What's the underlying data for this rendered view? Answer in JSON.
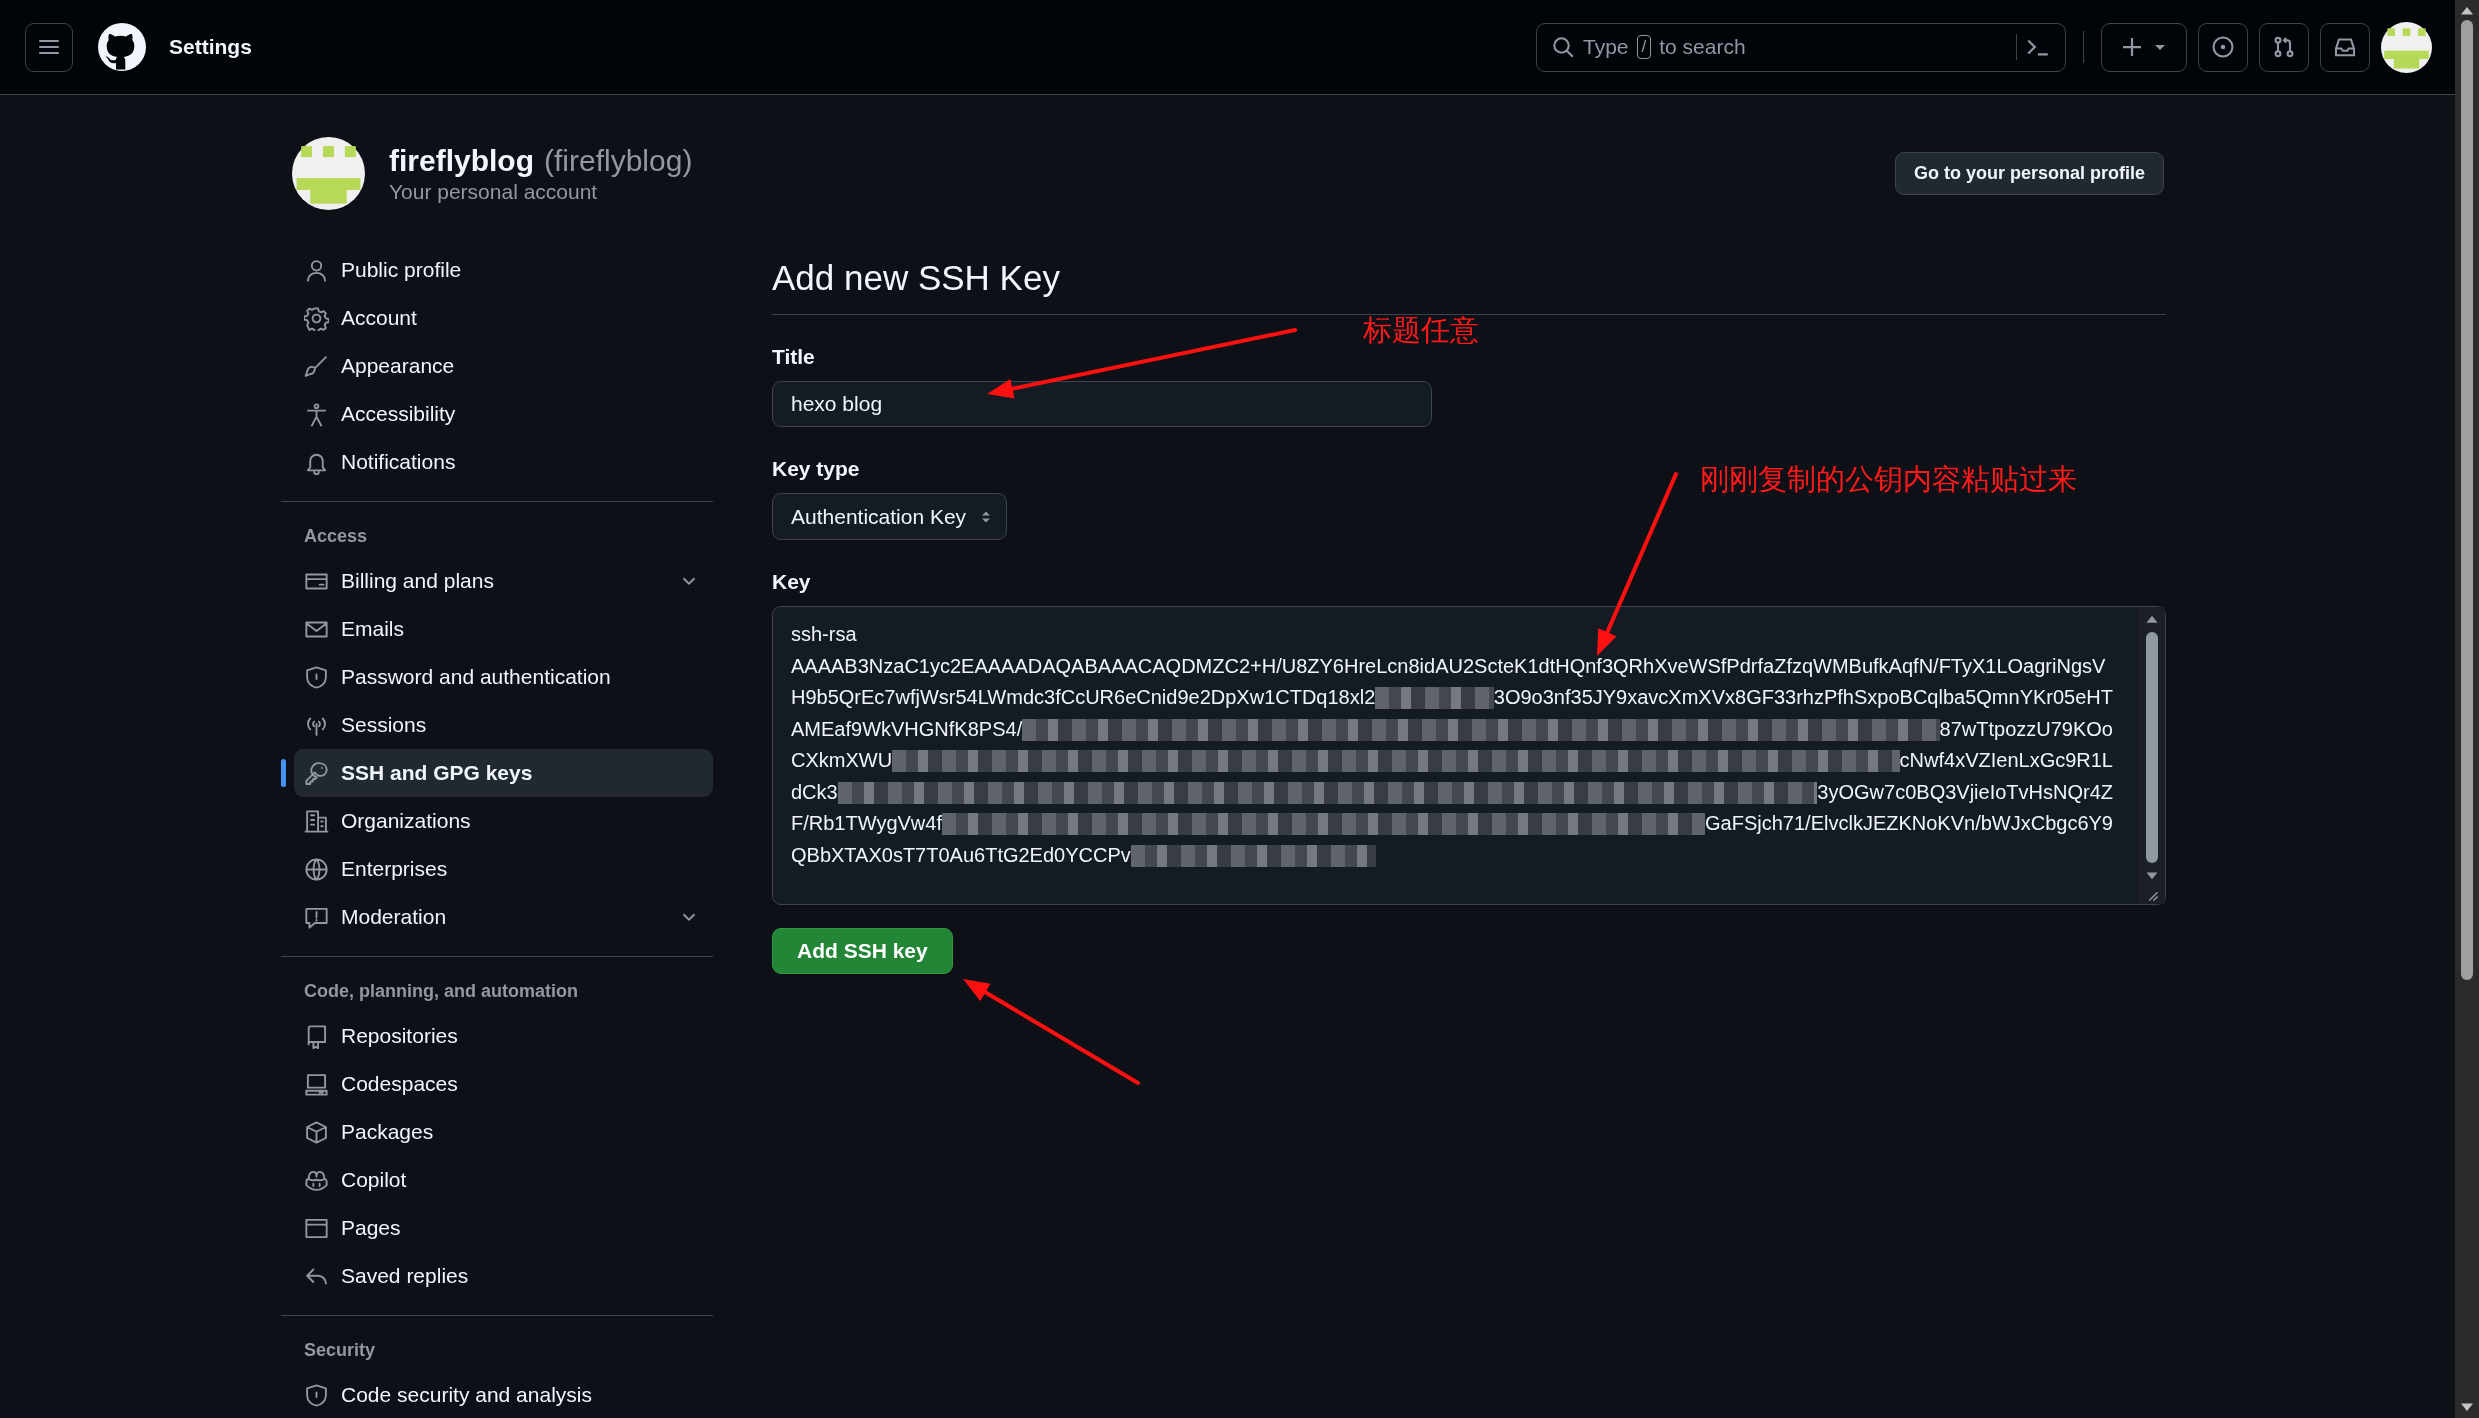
{
  "header": {
    "title": "Settings",
    "search": {
      "hint_start": "Type",
      "hint_key": "/",
      "hint_end": "to search"
    }
  },
  "profile": {
    "name": "fireflyblog",
    "login": "(fireflyblog)",
    "subtitle": "Your personal account",
    "button": "Go to your personal profile"
  },
  "sidebar": {
    "sections": [
      {
        "items": [
          {
            "label": "Public profile",
            "selected": false,
            "expandable": false
          },
          {
            "label": "Account",
            "selected": false,
            "expandable": false
          },
          {
            "label": "Appearance",
            "selected": false,
            "expandable": false
          },
          {
            "label": "Accessibility",
            "selected": false,
            "expandable": false
          },
          {
            "label": "Notifications",
            "selected": false,
            "expandable": false
          }
        ]
      },
      {
        "heading": "Access",
        "items": [
          {
            "label": "Billing and plans",
            "selected": false,
            "expandable": true
          },
          {
            "label": "Emails",
            "selected": false,
            "expandable": false
          },
          {
            "label": "Password and authentication",
            "selected": false,
            "expandable": false
          },
          {
            "label": "Sessions",
            "selected": false,
            "expandable": false
          },
          {
            "label": "SSH and GPG keys",
            "selected": true,
            "expandable": false
          },
          {
            "label": "Organizations",
            "selected": false,
            "expandable": false
          },
          {
            "label": "Enterprises",
            "selected": false,
            "expandable": false
          },
          {
            "label": "Moderation",
            "selected": false,
            "expandable": true
          }
        ]
      },
      {
        "heading": "Code, planning, and automation",
        "items": [
          {
            "label": "Repositories",
            "selected": false,
            "expandable": false
          },
          {
            "label": "Codespaces",
            "selected": false,
            "expandable": false
          },
          {
            "label": "Packages",
            "selected": false,
            "expandable": false
          },
          {
            "label": "Copilot",
            "selected": false,
            "expandable": false
          },
          {
            "label": "Pages",
            "selected": false,
            "expandable": false
          },
          {
            "label": "Saved replies",
            "selected": false,
            "expandable": false
          }
        ]
      },
      {
        "heading": "Security",
        "items": [
          {
            "label": "Code security and analysis",
            "selected": false,
            "expandable": false
          }
        ]
      }
    ]
  },
  "form": {
    "heading": "Add new SSH Key",
    "title_label": "Title",
    "title_value": "hexo blog",
    "type_label": "Key type",
    "type_value": "Authentication Key",
    "key_label": "Key",
    "key_lines": [
      {
        "start": "ssh-rsa",
        "redacted": false
      },
      {
        "start": "AAAAB3NzaC1yc2EAAAADAQABAAACAQDMZC2+H/U8ZY6HreLcn8idAU2ScteK1dtHQnf3QRhXveWSfPdrfaZfzqWMBufkAqfN/FTyX1LOagriNgsV",
        "redacted": false
      },
      {
        "start": "H9b5QrEc7wfjWsr54LWmdc3fCcUR6eCnid9e2DpXw1CTDq18xl2",
        "end": "3O9o3nf35JY9xavcXmXVx8GF33rhzPfhSxpoBCqlba5QmnYKr05eHT",
        "redacted": true
      },
      {
        "start": "AMEaf9WkVHGNfK8PS4/",
        "end": "87wTtpozzU79KOo",
        "redacted": true
      },
      {
        "start": "CXkmXWU",
        "end": "cNwf4xVZIenLxGc9R1L",
        "redacted": true
      },
      {
        "start": "dCk3",
        "end": "3yOGw7c0BQ3VjieIoTvHsNQr4Z",
        "redacted": true
      },
      {
        "start": "F/Rb1TWygVw4f",
        "end": "GaFSjch71/ElvclkJEZKNoKVn/bWJxCbgc6Y9",
        "redacted": true
      },
      {
        "start": "QBbXTAX0sT7T0Au6TtG2Ed0YCCPv",
        "redacted": true
      }
    ],
    "submit": "Add SSH key"
  },
  "annotations": [
    {
      "text": "标题任意"
    },
    {
      "text": "刚刚复制的公钥内容粘贴过来"
    }
  ]
}
